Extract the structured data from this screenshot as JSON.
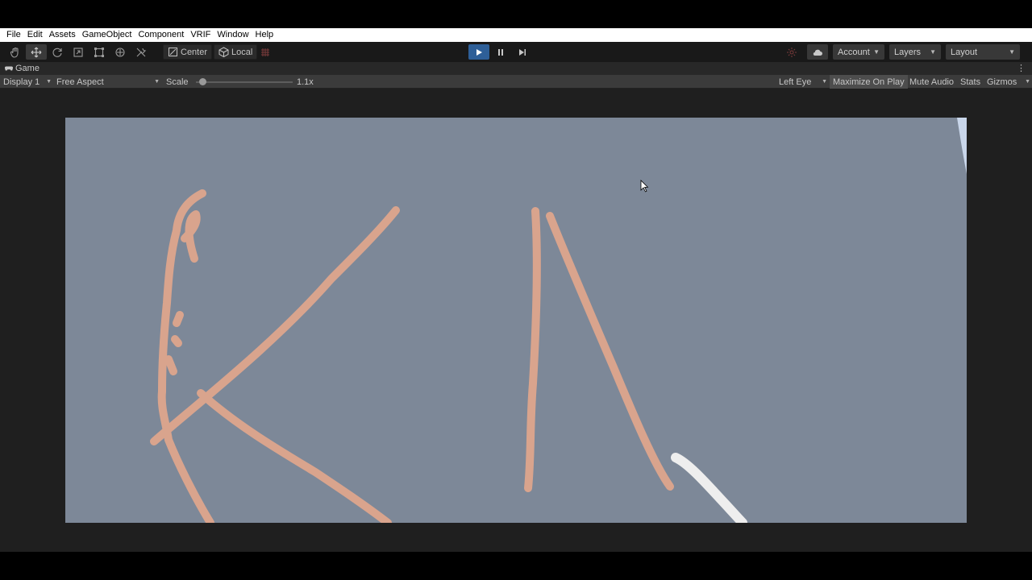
{
  "menu": {
    "items": [
      "File",
      "Edit",
      "Assets",
      "GameObject",
      "Component",
      "VRIF",
      "Window",
      "Help"
    ]
  },
  "toolbar": {
    "pivot_label": "Center",
    "space_label": "Local",
    "account_label": "Account",
    "layers_label": "Layers",
    "layout_label": "Layout"
  },
  "tab": {
    "title": "Game"
  },
  "game_bar": {
    "display": "Display 1",
    "aspect": "Free Aspect",
    "scale_label": "Scale",
    "scale_value": "1.1x",
    "scale_fraction": 0.03,
    "eye": "Left Eye",
    "maximize": "Maximize On Play",
    "mute": "Mute Audio",
    "stats": "Stats",
    "gizmos": "Gizmos"
  },
  "play_state": "playing",
  "colors": {
    "scene_background": "#7d8898",
    "stroke": "#d9a48d",
    "play_active": "#2e5f98"
  }
}
